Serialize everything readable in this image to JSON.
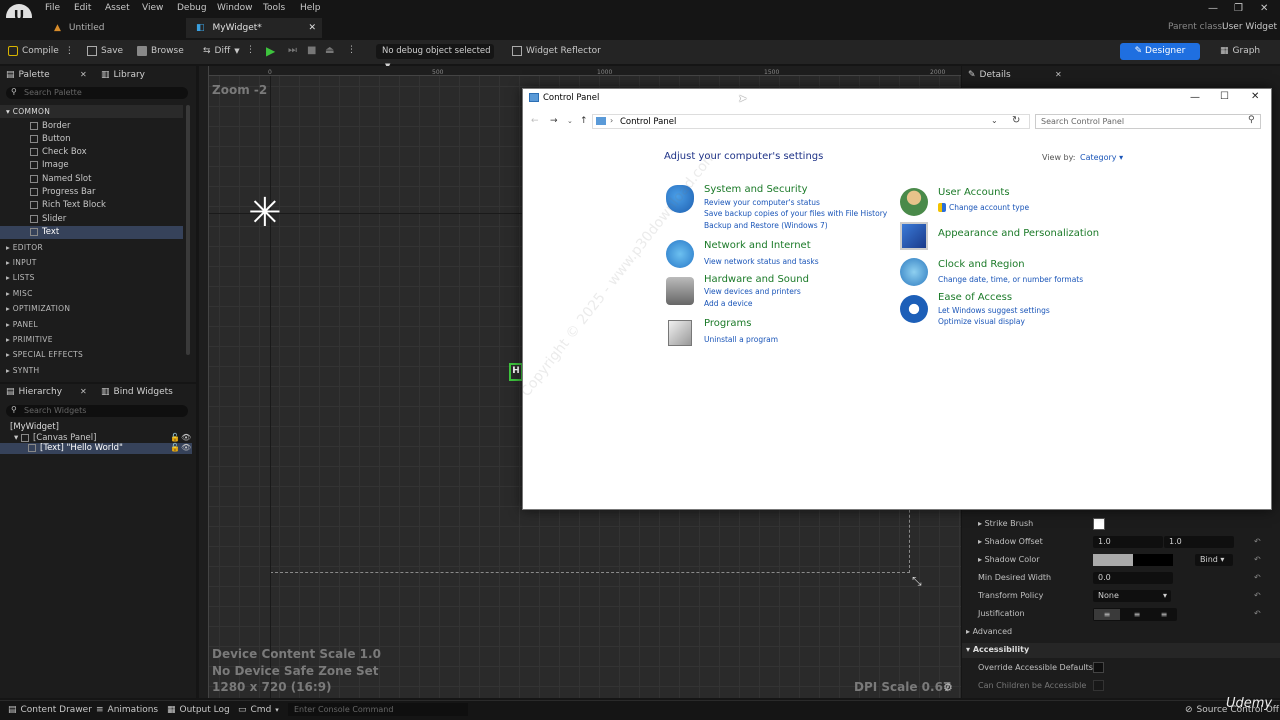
{
  "menu": {
    "items": [
      "File",
      "Edit",
      "Asset",
      "View",
      "Debug",
      "Window",
      "Tools",
      "Help"
    ],
    "logo": "U"
  },
  "tabs": {
    "untitled": "Untitled",
    "mywidget": "MyWidget*",
    "parent_class_label": "Parent class:",
    "parent_class_value": "User Widget"
  },
  "toolbar": {
    "compile": "Compile",
    "save": "Save",
    "browse": "Browse",
    "diff": "Diff",
    "debug_object": "No debug object selected",
    "widget_reflector": "Widget Reflector",
    "designer": "Designer",
    "graph": "Graph"
  },
  "palette": {
    "tab_palette": "Palette",
    "tab_library": "Library",
    "search_placeholder": "Search Palette",
    "common_label": "COMMON",
    "common_items": [
      "Border",
      "Button",
      "Check Box",
      "Image",
      "Named Slot",
      "Progress Bar",
      "Rich Text Block",
      "Slider",
      "Text"
    ],
    "categories": [
      "EDITOR",
      "INPUT",
      "LISTS",
      "MISC",
      "OPTIMIZATION",
      "PANEL",
      "PRIMITIVE",
      "SPECIAL EFFECTS",
      "SYNTH"
    ]
  },
  "hierarchy": {
    "tab_hierarchy": "Hierarchy",
    "tab_bind": "Bind Widgets",
    "search_placeholder": "Search Widgets",
    "root": "[MyWidget]",
    "canvas": "[Canvas Panel]",
    "text": "[Text] \"Hello World\""
  },
  "viewport": {
    "zoom": "Zoom -2",
    "ruler_labels": [
      "0",
      "500",
      "1000",
      "1500",
      "2000"
    ],
    "scale": "Device Content Scale 1.0",
    "safe_zone": "No Device Safe Zone Set",
    "resolution": "1280 x 720 (16:9)",
    "dpi": "DPI Scale 0.67"
  },
  "details": {
    "tab": "Details",
    "strike_brush": "Strike Brush",
    "shadow_offset": "Shadow Offset",
    "shadow_offset_x": "1.0",
    "shadow_offset_y": "1.0",
    "shadow_color": "Shadow Color",
    "bind": "Bind",
    "min_desired_width": "Min Desired Width",
    "min_desired_width_val": "0.0",
    "transform_policy": "Transform Policy",
    "transform_policy_val": "None",
    "justification": "Justification",
    "advanced": "Advanced",
    "accessibility": "Accessibility",
    "override_accessible": "Override Accessible Defaults",
    "can_children": "Can Children be Accessible"
  },
  "bottom": {
    "content_drawer": "Content Drawer",
    "animations": "Animations",
    "output_log": "Output Log",
    "cmd": "Cmd",
    "console_placeholder": "Enter Console Command",
    "source_control": "Source Control Off",
    "watermark": "Udemy"
  },
  "control_panel": {
    "title": "Control Panel",
    "breadcrumb": "Control Panel",
    "search_placeholder": "Search Control Panel",
    "heading": "Adjust your computer's settings",
    "view_by_label": "View by:",
    "view_by_value": "Category",
    "left_categories": [
      {
        "title": "System and Security",
        "links": [
          "Review your computer's status",
          "Save backup copies of your files with File History",
          "Backup and Restore (Windows 7)"
        ]
      },
      {
        "title": "Network and Internet",
        "links": [
          "View network status and tasks"
        ]
      },
      {
        "title": "Hardware and Sound",
        "links": [
          "View devices and printers",
          "Add a device"
        ]
      },
      {
        "title": "Programs",
        "links": [
          "Uninstall a program"
        ]
      }
    ],
    "right_categories": [
      {
        "title": "User Accounts",
        "links": [
          "Change account type"
        ]
      },
      {
        "title": "Appearance and Personalization",
        "links": []
      },
      {
        "title": "Clock and Region",
        "links": [
          "Change date, time, or number formats"
        ]
      },
      {
        "title": "Ease of Access",
        "links": [
          "Let Windows suggest settings",
          "Optimize visual display"
        ]
      }
    ],
    "watermark": "Copyright © 2025 - www.p30download.com"
  },
  "colors": {
    "accent": "#1f6fe0",
    "panel_bg": "#1c1c1c",
    "viewport_bg": "#2a2a2a",
    "cp_green": "#1b7a28",
    "cp_link": "#1a55b8"
  }
}
